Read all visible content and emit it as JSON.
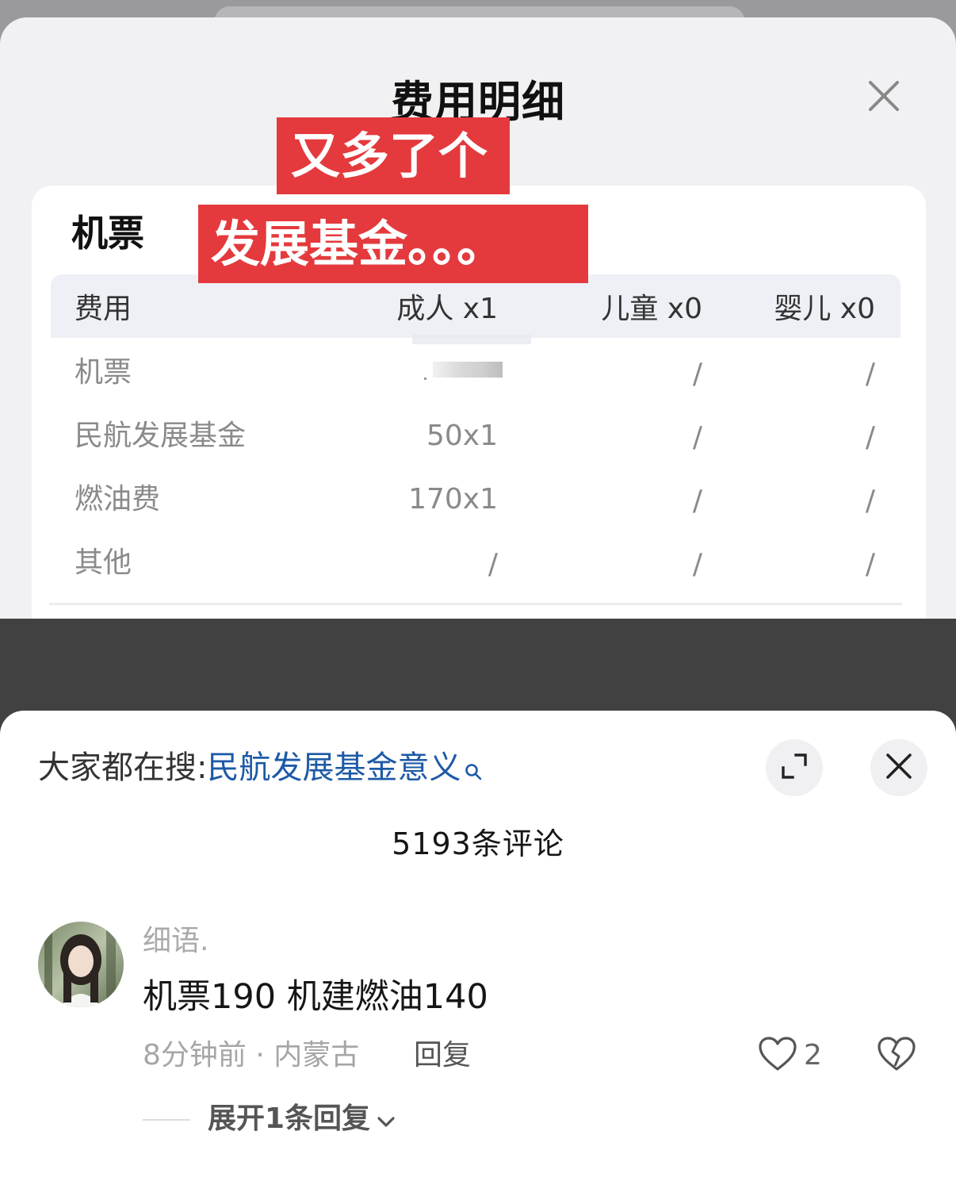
{
  "fee_sheet": {
    "title": "费用明细",
    "section_title": "机票",
    "columns": [
      "费用",
      "成人 x1",
      "儿童 x0",
      "婴儿 x0"
    ],
    "rows": [
      {
        "name": "机票",
        "adult": "",
        "child": "/",
        "infant": "/"
      },
      {
        "name": "民航发展基金",
        "adult": "50x1",
        "child": "/",
        "infant": "/"
      },
      {
        "name": "燃油费",
        "adult": "170x1",
        "child": "/",
        "infant": "/"
      },
      {
        "name": "其他",
        "adult": "/",
        "child": "/",
        "infant": "/"
      }
    ]
  },
  "captions": {
    "line1": "又多了个",
    "line2": "发展基金。。。"
  },
  "search": {
    "prefix": "大家都在搜:",
    "term": "民航发展基金意义"
  },
  "comment_count": "5193条评论",
  "comment": {
    "username": "细语.",
    "text": "机票190 机建燃油140",
    "time_location": "8分钟前 · 内蒙古",
    "reply_label": "回复",
    "likes": "2",
    "expand_label": "展开1条回复"
  },
  "colors": {
    "sticker_red": "#e43a3d",
    "search_link": "#1d5aa6",
    "dark_band": "#414141"
  },
  "icons": [
    "close-icon",
    "search-icon",
    "expand-icon",
    "heart-icon",
    "broken-heart-icon",
    "chevron-down-icon"
  ]
}
